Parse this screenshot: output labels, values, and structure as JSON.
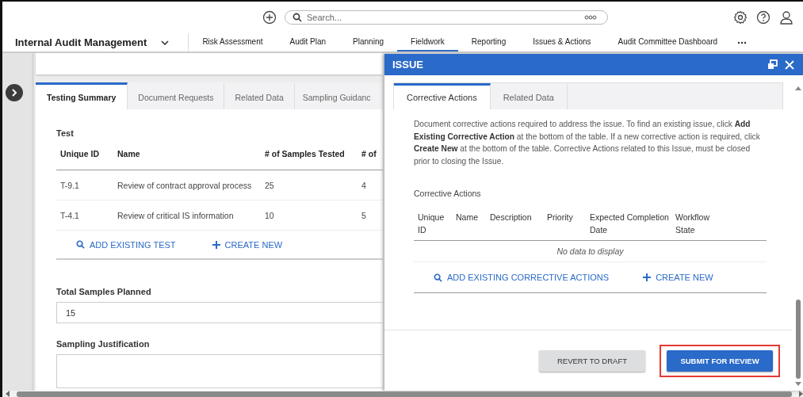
{
  "top_bar": {
    "search": {
      "placeholder": "Search..."
    }
  },
  "nav": {
    "app_title": "Internal Audit Management",
    "items": [
      {
        "label": "Risk Assessment",
        "selected": false
      },
      {
        "label": "Audit Plan",
        "selected": false
      },
      {
        "label": "Planning",
        "selected": false
      },
      {
        "label": "Fieldwork",
        "selected": true
      },
      {
        "label": "Reporting",
        "selected": false
      },
      {
        "label": "Issues & Actions",
        "selected": false
      },
      {
        "label": "Audit Committee Dashboard",
        "selected": false
      }
    ]
  },
  "main": {
    "tabs": [
      {
        "label": "Testing Summary",
        "selected": true
      },
      {
        "label": "Document Requests",
        "selected": false
      },
      {
        "label": "Related Data",
        "selected": false
      },
      {
        "label": "Sampling Guidanc",
        "selected": false
      }
    ],
    "test_table": {
      "title": "Test",
      "columns": [
        "Unique ID",
        "Name",
        "# of Samples Tested",
        "# of"
      ],
      "rows": [
        [
          "T-9.1",
          "Review of contract approval process",
          "25",
          "4"
        ],
        [
          "T-4.1",
          "Review of critical IS information",
          "10",
          "5"
        ]
      ],
      "actions": [
        {
          "kind": "search",
          "label": "ADD EXISTING TEST"
        },
        {
          "kind": "create",
          "label": "CREATE NEW"
        }
      ]
    },
    "total_samples": {
      "label": "Total Samples Planned",
      "value": "15"
    },
    "justification": {
      "label": "Sampling Justification"
    }
  },
  "issue_panel": {
    "title": "ISSUE",
    "tabs": [
      {
        "label": "Corrective Actions",
        "selected": true
      },
      {
        "label": "Related Data",
        "selected": false
      }
    ],
    "description": "Document corrective actions required to address the issue. To find an existing issue, click **Add Existing Corrective Action** at the bottom of the table. If a new corrective action is required, click **Create New** at the bottom of the table. Corrective Actions related to this Issue, must be closed prior to closing the Issue.",
    "table": {
      "title": "Corrective Actions",
      "columns": [
        "Unique ID",
        "Name",
        "Description",
        "Priority",
        "Expected Completion Date",
        "Workflow State"
      ],
      "empty_text": "No data to display",
      "actions": [
        {
          "kind": "search",
          "label": "ADD EXISTING CORRECTIVE ACTIONS"
        },
        {
          "kind": "create",
          "label": "CREATE NEW"
        }
      ]
    },
    "buttons": [
      {
        "kind": "secondary",
        "label": "REVERT TO DRAFT",
        "highlighted": false
      },
      {
        "kind": "primary",
        "label": "SUBMIT FOR REVIEW",
        "highlighted": true
      }
    ]
  }
}
